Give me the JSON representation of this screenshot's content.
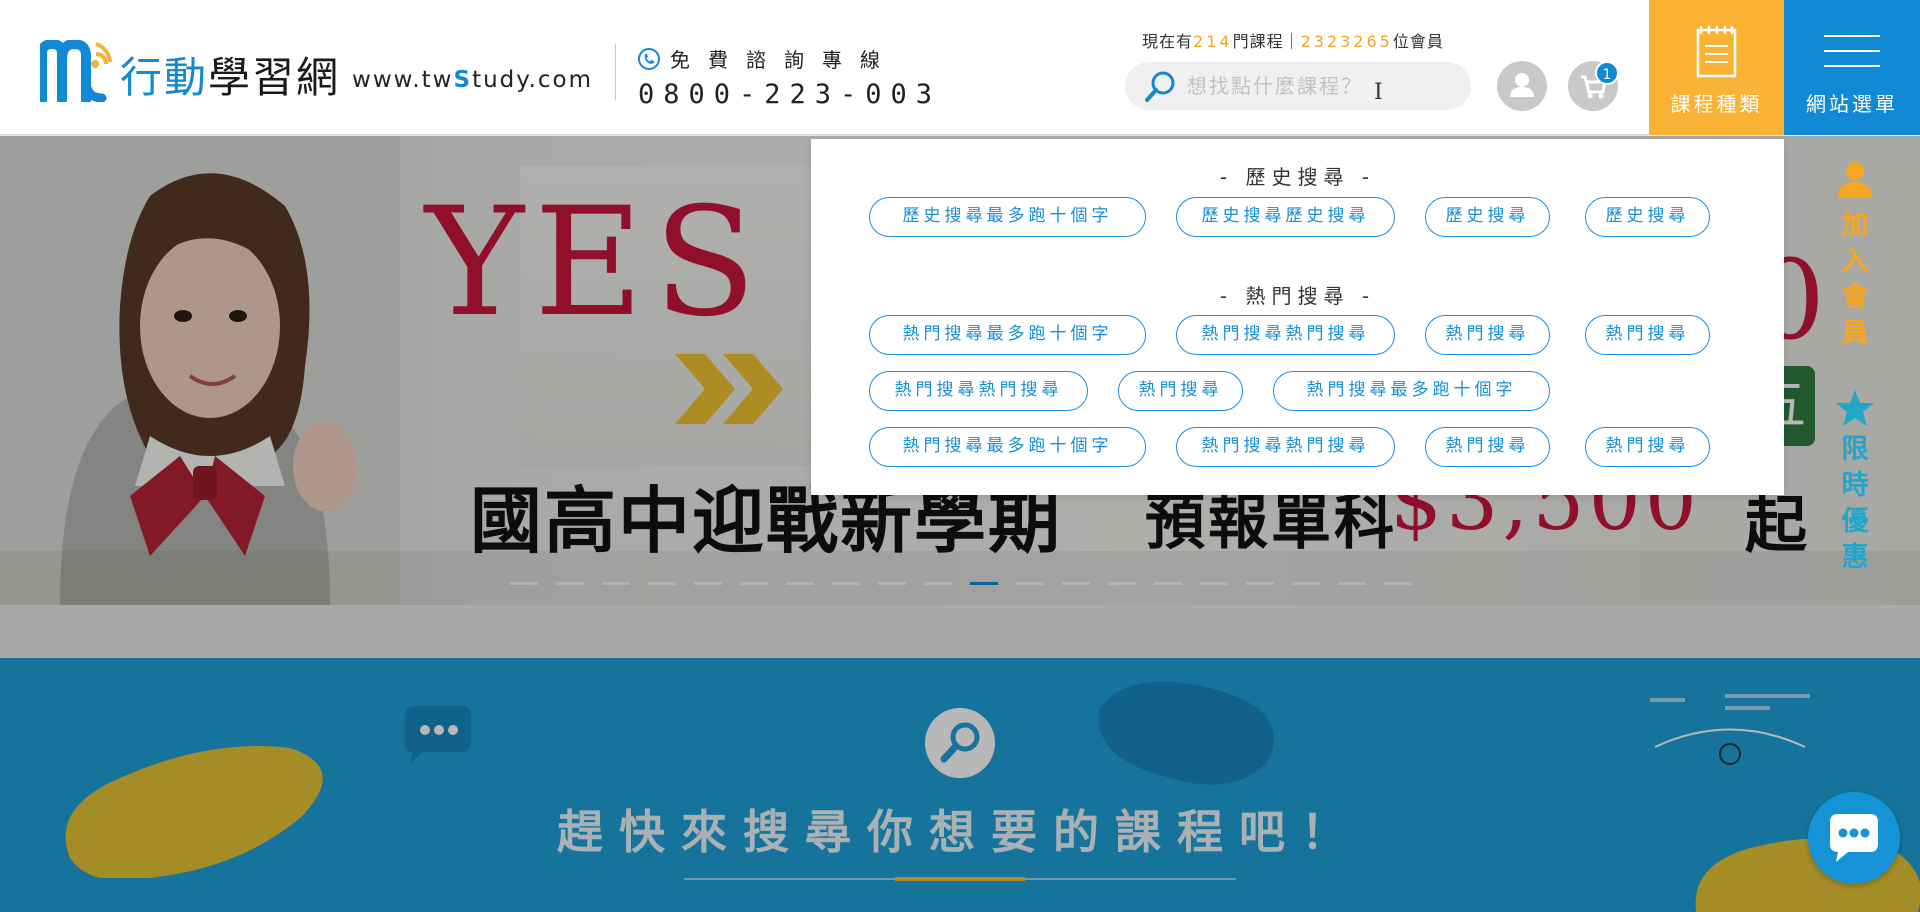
{
  "header": {
    "logo_name_part1": "行動",
    "logo_name_part2": "學習網",
    "logo_url_1": "www.tw",
    "logo_url_2": "S",
    "logo_url_3": "tudy.com",
    "hotline_label": "免費諮詢專線",
    "hotline_number": "0800-223-003",
    "stats": {
      "prefix": "現在有",
      "courses": "214",
      "mid": "門課程｜",
      "members": "2323265",
      "suffix": "位會員"
    },
    "search_placeholder": "想找點什麼課程？",
    "cart_count": "1",
    "course_types_label": "課程種類",
    "site_menu_label": "網站選單"
  },
  "banner": {
    "yes": "YES",
    "headline": "國高中迎戰新學期",
    "sub": "預報單科",
    "price": "$3,500",
    "price_suffix": "起",
    "right_digit": "0",
    "green_badge": "五",
    "slides": 20,
    "active_slide": 10
  },
  "side": {
    "join_member": "加入會員",
    "limited_offer": "限時優惠"
  },
  "search_section": {
    "title": "趕快來搜尋你想要的課程吧！"
  },
  "dropdown": {
    "history_title": "- 歷史搜尋 -",
    "history": [
      "歷史搜尋最多跑十個字",
      "歷史搜尋歷史搜尋",
      "歷史搜尋",
      "歷史搜尋"
    ],
    "hot_title": "- 熱門搜尋 -",
    "hot_row1": [
      "熱門搜尋最多跑十個字",
      "熱門搜尋熱門搜尋",
      "熱門搜尋",
      "熱門搜尋"
    ],
    "hot_row2": [
      "熱門搜尋熱門搜尋",
      "熱門搜尋",
      "熱門搜尋最多跑十個字"
    ],
    "hot_row3": [
      "熱門搜尋最多跑十個字",
      "熱門搜尋熱門搜尋",
      "熱門搜尋",
      "熱門搜尋"
    ]
  },
  "colors": {
    "brand_blue": "#1289d4",
    "accent_orange": "#f9b233",
    "brand_red": "#c8163b",
    "section_blue": "#1fa1d8"
  }
}
